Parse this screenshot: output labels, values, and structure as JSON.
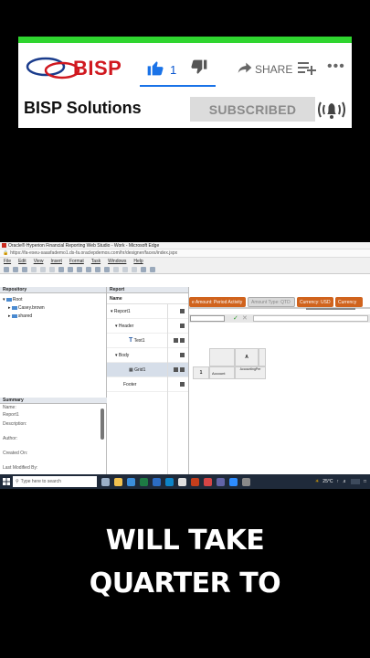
{
  "banner": {
    "logo_text": "BISP",
    "like_count": "1",
    "share_label": "SHARE",
    "channel_name": "BISP Solutions",
    "subscribed_label": "SUBSCRIBED"
  },
  "browser": {
    "window_title": "Oracle® Hyperion Financial Reporting Web Studio - Work - Microsoft Edge",
    "url": "https://fa-eseu-saasfademo1.ds-fa.oraclepdemos.com/hr/designer/faces/index.jspx",
    "menu": [
      "File",
      "Edit",
      "View",
      "Insert",
      "Format",
      "Task",
      "Windows",
      "Help"
    ]
  },
  "repository": {
    "header": "Repository",
    "tree": [
      "Root",
      "Casey.brown",
      "shared"
    ]
  },
  "summary": {
    "header": "Summary",
    "rows": [
      "Name:",
      "Report1",
      "Description:",
      "Author:",
      "Created On:",
      "Last Modified By:"
    ]
  },
  "report": {
    "header": "Report",
    "col_name": "Name",
    "items": [
      "Report1",
      "Header",
      "Text1",
      "Body",
      "Grid1",
      "Footer"
    ]
  },
  "grid": {
    "pills": [
      "e Amount: Period Activity",
      "Amount Type: QTD",
      "Currency: USD",
      "Currency"
    ],
    "col_a": "A",
    "row1": "1",
    "account": "Account",
    "accounting_per": "AccountingPer"
  },
  "taskbar": {
    "search_placeholder": "Type here to search",
    "temp": "25°C"
  },
  "captions": {
    "line1": "WILL TAKE",
    "line2": "QUARTER TO"
  }
}
